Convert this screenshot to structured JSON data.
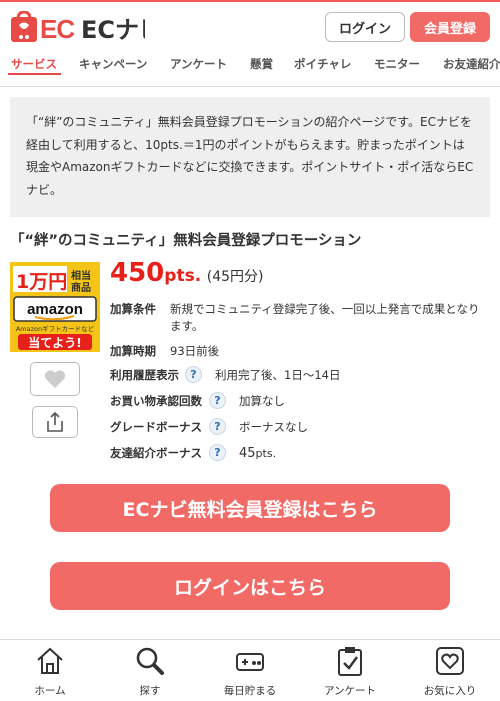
{
  "header": {
    "logo_text": "ECナビ",
    "login_label": "ログイン",
    "register_label": "会員登録"
  },
  "nav": {
    "tabs": [
      "サービス",
      "キャンペーン",
      "アンケート",
      "懸賞",
      "ポイチャレ",
      "モニター",
      "お友達紹介"
    ],
    "active_index": 0
  },
  "intro": {
    "text": "「“絆”のコミュニティ」無料会員登録プロモーションの紹介ページです。ECナビを経由して利用すると、10pts.＝1円のポイントがもらえます。貯まったポイントは現金やAmazonギフトカードなどに交換できます。ポイントサイト・ポイ活ならECナビ。"
  },
  "promotion": {
    "title": "「“絆”のコミュニティ」無料会員登録プロモーション",
    "banner": {
      "amount": "1万円",
      "equiv": "相当",
      "product": "商品",
      "brand": "amazon",
      "sub": "Amazonギフトカードなど",
      "cta": "当てよう!"
    },
    "points": "450",
    "points_unit": "pts.",
    "yen": "(45円分)",
    "details": [
      {
        "label": "加算条件",
        "value": "新規でコミュニティ登録完了後、一回以上発言で成果となります。",
        "help": false
      },
      {
        "label": "加算時期",
        "value": "93日前後",
        "help": false
      },
      {
        "label": "利用履歴表示",
        "value": "利用完了後、1日～14日",
        "help": true
      },
      {
        "label": "お買い物承認回数",
        "value": "加算なし",
        "help": true
      },
      {
        "label": "グレードボーナス",
        "value": "ボーナスなし",
        "help": true
      },
      {
        "label": "友達紹介ボーナス",
        "value": "45",
        "value_unit": "pts.",
        "help": true
      }
    ],
    "help_glyph": "?"
  },
  "cta": {
    "register": "ECナビ無料会員登録はこちら",
    "login": "ログインはこちら"
  },
  "bottom_nav": [
    {
      "label": "ホーム",
      "icon": "home-icon"
    },
    {
      "label": "探す",
      "icon": "search-icon"
    },
    {
      "label": "毎日貯まる",
      "icon": "gamepad-icon"
    },
    {
      "label": "アンケート",
      "icon": "clipboard-icon"
    },
    {
      "label": "お気に入り",
      "icon": "favorite-icon"
    }
  ],
  "colors": {
    "accent": "#f26a66",
    "points_red": "#e8201a",
    "link_blue": "#2d6fb7"
  }
}
